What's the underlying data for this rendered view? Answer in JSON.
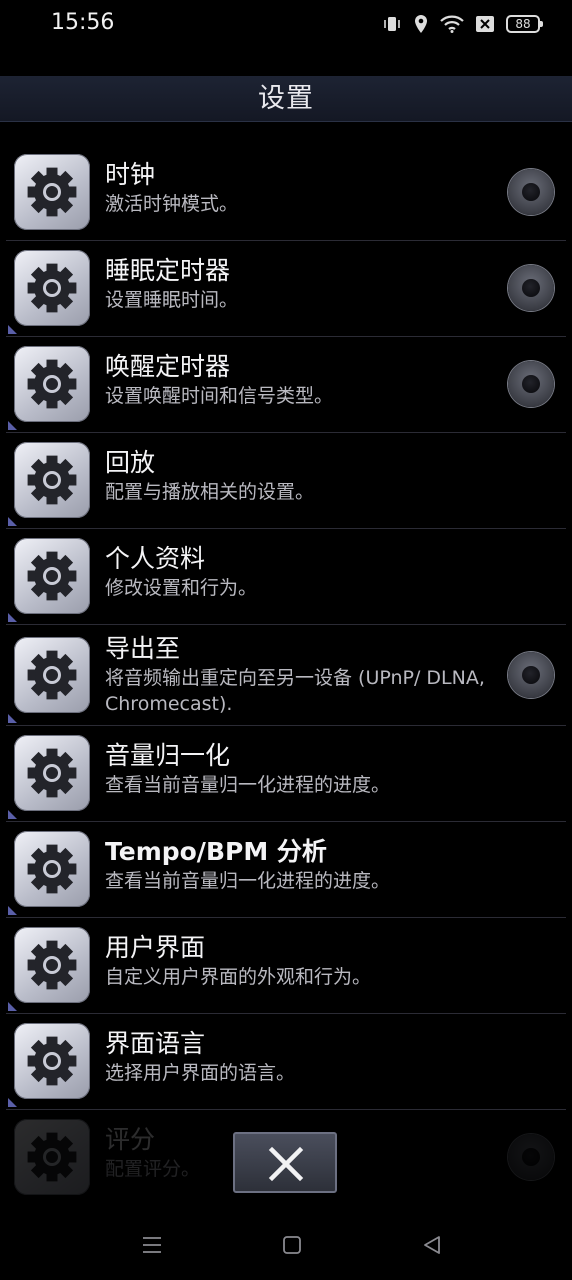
{
  "status_bar": {
    "time": "15:56",
    "battery": "88",
    "icons": [
      "vibrate-icon",
      "location-icon",
      "wifi-icon",
      "sim-off-icon",
      "battery-icon"
    ]
  },
  "header": {
    "title": "设置"
  },
  "items": [
    {
      "title": "时钟",
      "subtitle": "激活时钟模式。",
      "has_toggle": true,
      "toggle_on": false
    },
    {
      "title": "睡眠定时器",
      "subtitle": "设置睡眠时间。",
      "has_toggle": true,
      "toggle_on": false
    },
    {
      "title": "唤醒定时器",
      "subtitle": "设置唤醒时间和信号类型。",
      "has_toggle": true,
      "toggle_on": false
    },
    {
      "title": "回放",
      "subtitle": "配置与播放相关的设置。",
      "has_toggle": false
    },
    {
      "title": "个人资料",
      "subtitle": "修改设置和行为。",
      "has_toggle": false
    },
    {
      "title": "导出至",
      "subtitle": "将音频输出重定向至另一设备 (UPnP/ DLNA, Chromecast).",
      "has_toggle": true,
      "toggle_on": false
    },
    {
      "title": "音量归一化",
      "subtitle": "查看当前音量归一化进程的进度。",
      "has_toggle": false
    },
    {
      "title": "Tempo/BPM 分析",
      "subtitle": "查看当前音量归一化进程的进度。",
      "has_toggle": false
    },
    {
      "title": "用户界面",
      "subtitle": "自定义用户界面的外观和行为。",
      "has_toggle": false
    },
    {
      "title": "界面语言",
      "subtitle": "选择用户界面的语言。",
      "has_toggle": false
    },
    {
      "title": "评分",
      "subtitle": "配置评分。",
      "has_toggle": true,
      "toggle_on": false
    }
  ],
  "close_button": {
    "icon": "close-icon"
  },
  "navigation_bar": {
    "buttons": [
      "menu-icon",
      "home-icon",
      "back-icon"
    ]
  },
  "colors": {
    "background": "#000000",
    "header": "#1d2333",
    "accent_corner": "#5a5fa8"
  }
}
